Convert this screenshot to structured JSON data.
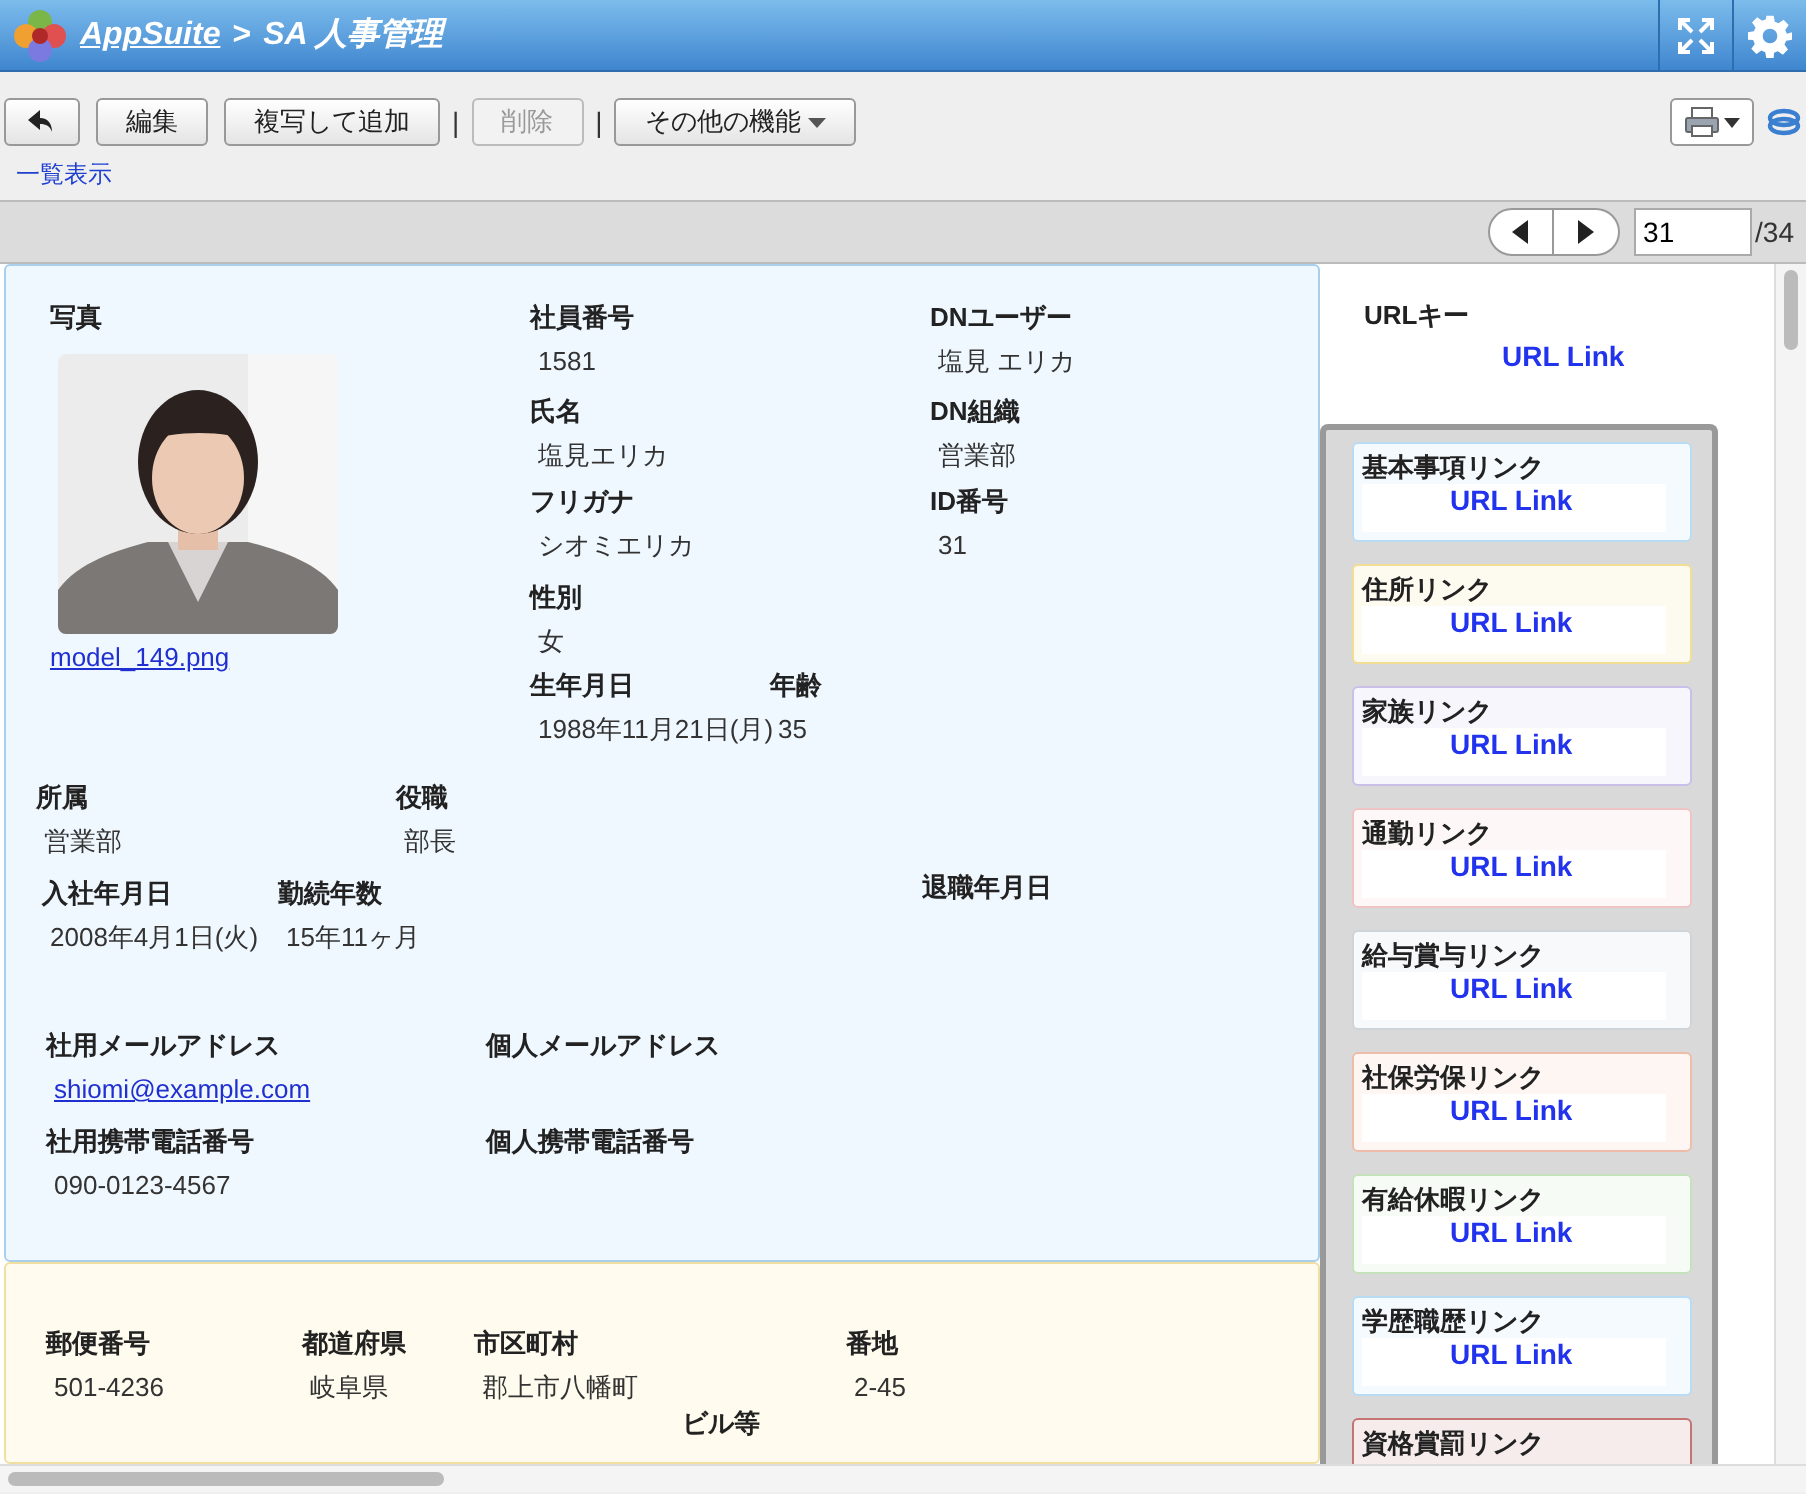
{
  "header": {
    "app": "AppSuite",
    "separator": ">",
    "title": "SA 人事管理"
  },
  "toolbar": [
    {
      "kind": "back"
    },
    {
      "kind": "text",
      "label": "編集",
      "disabled": false
    },
    {
      "kind": "text",
      "label": "複写して追加",
      "disabled": false
    },
    {
      "kind": "separator",
      "label": "|"
    },
    {
      "kind": "text",
      "label": "削除",
      "disabled": true
    },
    {
      "kind": "separator",
      "label": "|"
    },
    {
      "kind": "menu",
      "label": "その他の機能",
      "disabled": false
    }
  ],
  "list_link": "一覧表示",
  "pager": {
    "current": "31",
    "total": "/34"
  },
  "photo": {
    "label": "写真",
    "file": "model_149.png",
    "kind": "picture"
  },
  "sections": [
    {
      "fields": [
        {
          "label": "社員番号",
          "value": "1581",
          "kind": "text"
        },
        {
          "label": "DNユーザー",
          "value": "塩見 エリカ",
          "kind": "text"
        },
        {
          "label": "氏名",
          "value": "塩見エリカ",
          "kind": "text"
        },
        {
          "label": "DN組織",
          "value": "営業部",
          "kind": "text"
        },
        {
          "label": "フリガナ",
          "value": "シオミエリカ",
          "kind": "text"
        },
        {
          "label": "ID番号",
          "value": "31",
          "kind": "text"
        },
        {
          "label": "性別",
          "value": "女",
          "kind": "text"
        },
        {
          "label": "生年月日",
          "value": "1988年11月21日(月)",
          "kind": "text"
        },
        {
          "label": "年齢",
          "value": "35",
          "kind": "text"
        },
        {
          "label": "所属",
          "value": "営業部",
          "kind": "text"
        },
        {
          "label": "役職",
          "value": "部長",
          "kind": "text"
        },
        {
          "label": "入社年月日",
          "value": "2008年4月1日(火)",
          "kind": "text"
        },
        {
          "label": "勤続年数",
          "value": "15年11ヶ月",
          "kind": "text"
        },
        {
          "label": "退職年月日"
        },
        {
          "label": "社用メールアドレス",
          "value": "shiomi@example.com",
          "kind": "link"
        },
        {
          "label": "個人メールアドレス"
        },
        {
          "label": "社用携帯電話番号",
          "value": "090-0123-4567",
          "kind": "text"
        },
        {
          "label": "個人携帯電話番号"
        }
      ]
    },
    {
      "fields": [
        {
          "label": "郵便番号",
          "value": "501-4236",
          "kind": "text"
        },
        {
          "label": "都道府県",
          "value": "岐阜県",
          "kind": "text"
        },
        {
          "label": "市区町村",
          "value": "郡上市八幡町",
          "kind": "text"
        },
        {
          "label": "番地",
          "value": "2-45",
          "kind": "text"
        },
        {
          "label": "ビル等"
        }
      ]
    }
  ],
  "url_key": {
    "label": "URLキー",
    "link": "URL Link"
  },
  "link_cards": [
    {
      "title": "基本事項リンク",
      "link": "URL Link",
      "color": "#b9dcf5"
    },
    {
      "title": "住所リンク",
      "link": "URL Link",
      "color": "#f2dd94"
    },
    {
      "title": "家族リンク",
      "link": "URL Link",
      "color": "#c9bfe8"
    },
    {
      "title": "通勤リンク",
      "link": "URL Link",
      "color": "#f0c4c4"
    },
    {
      "title": "給与賞与リンク",
      "link": "URL Link",
      "color": "#cfd4d9"
    },
    {
      "title": "社保労保リンク",
      "link": "URL Link",
      "color": "#efbcaa"
    },
    {
      "title": "有給休暇リンク",
      "link": "URL Link",
      "color": "#c6e2bc"
    },
    {
      "title": "学歴職歴リンク",
      "link": "URL Link",
      "color": "#b9dcf5"
    },
    {
      "title": "資格賞罰リンク",
      "color": "#c47474"
    }
  ]
}
